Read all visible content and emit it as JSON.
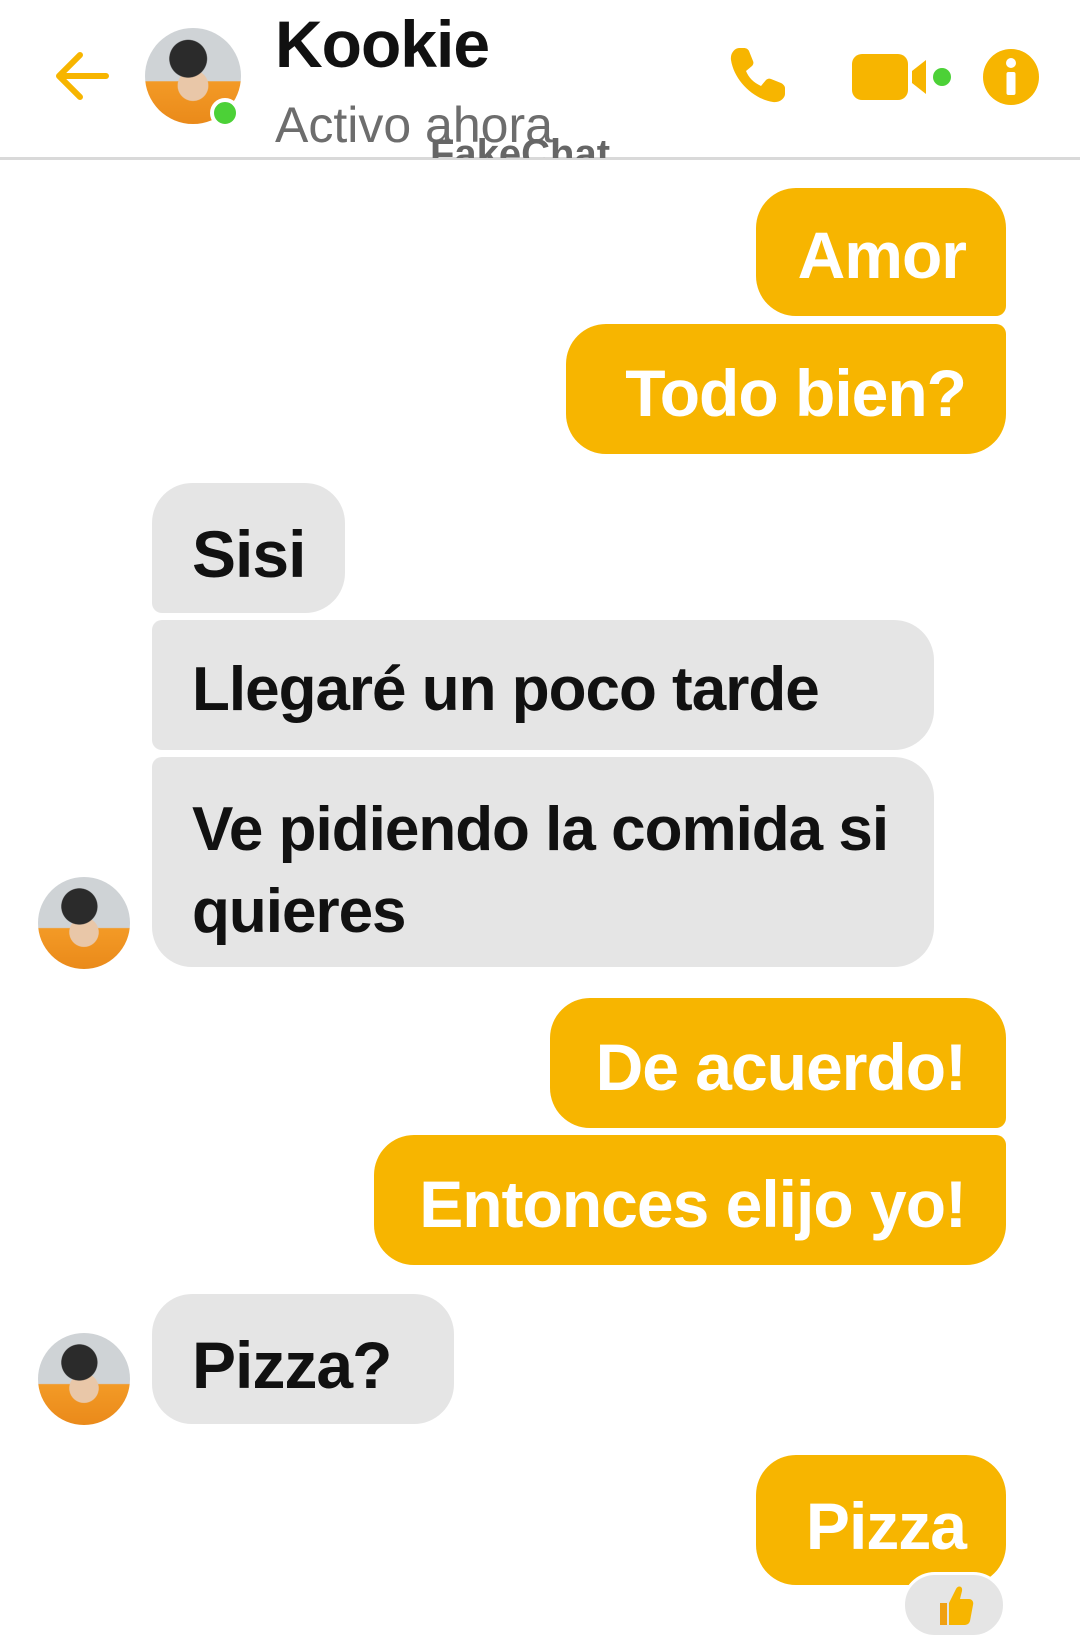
{
  "header": {
    "contact_name": "Kookie",
    "status": "Activo ahora",
    "watermark": "FakeChat",
    "icons": {
      "back": "arrow-left-icon",
      "call": "phone-icon",
      "video": "video-camera-icon",
      "info": "info-icon"
    }
  },
  "colors": {
    "accent": "#f7b500",
    "incoming_bubble": "#e5e5e5",
    "online": "#4cd137"
  },
  "messages": [
    {
      "side": "outgoing",
      "text": "Amor"
    },
    {
      "side": "outgoing",
      "text": "Todo bien?"
    },
    {
      "side": "incoming",
      "text": "Sisi"
    },
    {
      "side": "incoming",
      "text": "Llegaré un poco tarde"
    },
    {
      "side": "incoming",
      "text": "Ve pidiendo la comida si quieres"
    },
    {
      "side": "outgoing",
      "text": "De acuerdo!"
    },
    {
      "side": "outgoing",
      "text": "Entonces elijo yo!"
    },
    {
      "side": "incoming",
      "text": "Pizza?"
    },
    {
      "side": "outgoing",
      "text": "Pizza",
      "reaction": "👍"
    }
  ]
}
